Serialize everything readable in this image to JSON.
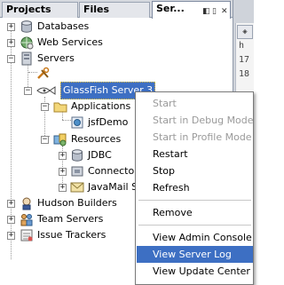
{
  "tabs": [
    {
      "label": "Projects"
    },
    {
      "label": "Files"
    },
    {
      "label": "Ser..."
    }
  ],
  "editor_lines": [
    "h",
    "17",
    "18"
  ],
  "tree": {
    "databases": "Databases",
    "web_services": "Web Services",
    "servers": "Servers",
    "glassfish": "GlassFish Server 3",
    "applications": "Applications",
    "jsfdemo": "jsfDemo",
    "resources": "Resources",
    "jdbc": "JDBC",
    "connectors": "Connector",
    "javamail": "JavaMail S",
    "hudson": "Hudson Builders",
    "team_servers": "Team Servers",
    "issue_trackers": "Issue Trackers"
  },
  "menu": {
    "start": "Start",
    "start_debug": "Start in Debug Mode",
    "start_profile": "Start in Profile Mode",
    "restart": "Restart",
    "stop": "Stop",
    "refresh": "Refresh",
    "remove": "Remove",
    "view_admin_console": "View Admin Console",
    "view_server_log": "View Server Log",
    "view_update_center": "View Update Center"
  },
  "colors": {
    "selection": "#3d6fc3",
    "tab_strip": "#d6d9df",
    "disabled_text": "#9a9a9a"
  },
  "icons": {
    "tab_controls": [
      "minimize-icon",
      "maximize-icon",
      "close-icon"
    ],
    "tree": [
      "database-icon",
      "globe-icon",
      "server-icon",
      "hudson-icon",
      "team-icon",
      "tracker-icon"
    ]
  }
}
